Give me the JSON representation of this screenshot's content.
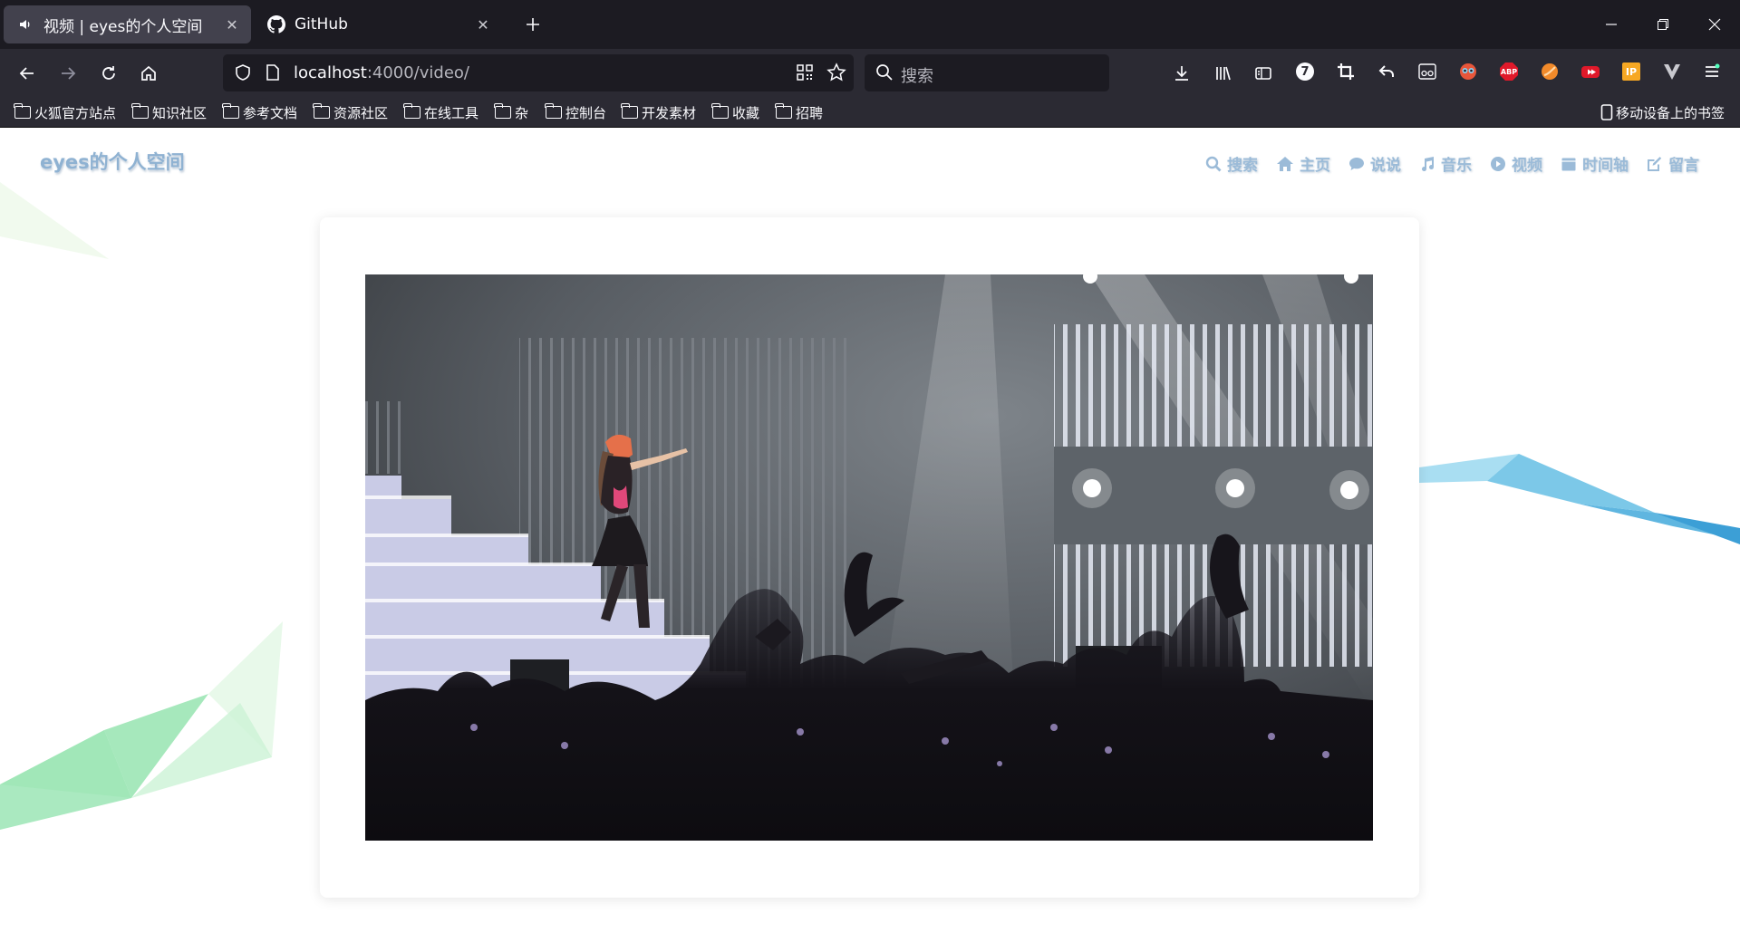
{
  "browser": {
    "tabs": [
      {
        "title": "视频 | eyes的个人空间",
        "icon": "speaker-icon",
        "active": true
      },
      {
        "title": "GitHub",
        "icon": "github-icon",
        "active": false
      }
    ],
    "url": {
      "host": "localhost",
      "rest": ":4000/video/"
    },
    "search_placeholder": "搜索",
    "bookmarks": [
      "火狐官方站点",
      "知识社区",
      "参考文档",
      "资源社区",
      "在线工具",
      "杂",
      "控制台",
      "开发素材",
      "收藏",
      "招聘"
    ],
    "mobile_bookmarks": "移动设备上的书签",
    "extensions": {
      "badge_number": "7",
      "abp": "ABP",
      "ip": "IP"
    }
  },
  "site": {
    "logo": "eyes的个人空间",
    "nav": [
      {
        "label": "搜索",
        "icon": "search-icon"
      },
      {
        "label": "主页",
        "icon": "home-icon"
      },
      {
        "label": "说说",
        "icon": "comment-icon"
      },
      {
        "label": "音乐",
        "icon": "music-icon"
      },
      {
        "label": "视频",
        "icon": "play-circle-icon"
      },
      {
        "label": "时间轴",
        "icon": "calendar-icon"
      },
      {
        "label": "留言",
        "icon": "edit-icon"
      }
    ],
    "video": {
      "description": "concert performer on stage"
    }
  },
  "colors": {
    "chrome_dark": "#1c1b22",
    "chrome": "#2b2a33",
    "tab_active": "#42414d",
    "nav_text": "#9bbbd8",
    "ribbon_blue": "#7cc8e8",
    "ribbon_green": "#9be5b5"
  }
}
